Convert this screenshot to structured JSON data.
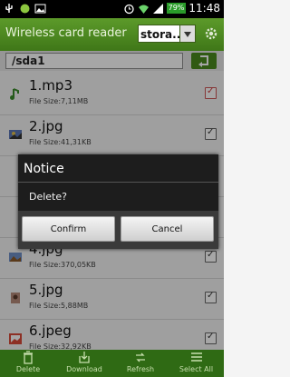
{
  "statusbar": {
    "battery": "79%",
    "time": "11:48",
    "icons": [
      "usb-icon",
      "android-icon",
      "image-icon",
      "alarm-icon",
      "wifi-icon",
      "signal-icon"
    ]
  },
  "header": {
    "title": "Wireless card reader",
    "storage_value": "stora...",
    "icons": [
      "chevron-down-icon",
      "gear-icon"
    ]
  },
  "pathbar": {
    "path": "/sda1",
    "back_icon": "back-arrow-icon"
  },
  "files": [
    {
      "name": "1.mp3",
      "size": "File Size:7,11MB",
      "icon": "music-note-icon",
      "checked": true
    },
    {
      "name": "2.jpg",
      "size": "File Size:41,31KB",
      "icon": "image-icon",
      "checked": true
    },
    {
      "name": "",
      "size": "",
      "icon": "image-icon",
      "checked": true
    },
    {
      "name": "",
      "size": "",
      "icon": "image-icon",
      "checked": true
    },
    {
      "name": "4.jpg",
      "size": "File Size:370,05KB",
      "icon": "image-icon",
      "checked": true
    },
    {
      "name": "5.jpg",
      "size": "File Size:5,88MB",
      "icon": "image-icon",
      "checked": true
    },
    {
      "name": "6.jpeg",
      "size": "File Size:32,92KB",
      "icon": "image-icon",
      "checked": true
    }
  ],
  "dialog": {
    "title": "Notice",
    "message": "Delete?",
    "confirm_label": "Confirm",
    "cancel_label": "Cancel"
  },
  "bottombar": {
    "delete_label": "Delete",
    "download_label": "Download",
    "refresh_label": "Refresh",
    "select_all_label": "Select All"
  },
  "colors": {
    "header_green": "#4f8a22",
    "bottom_green": "#2f6a14",
    "checkbox_red": "#cf3b3b"
  }
}
